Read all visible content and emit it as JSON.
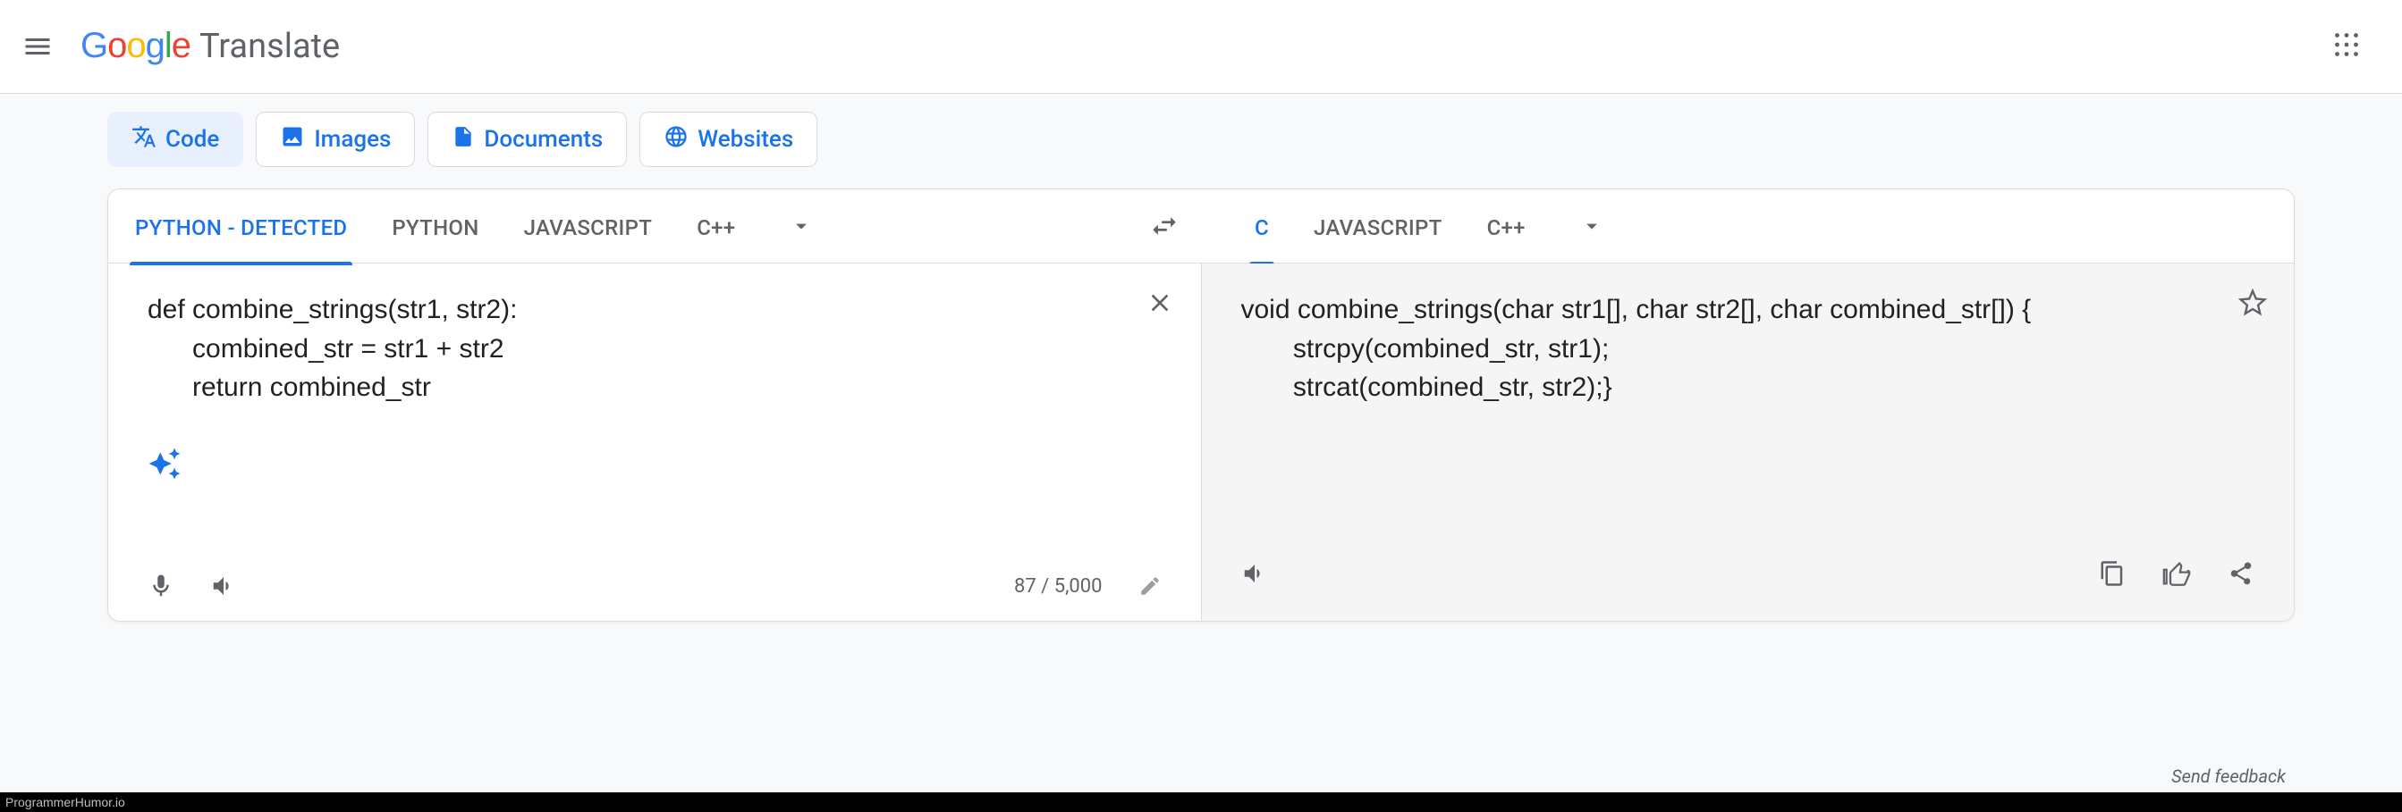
{
  "header": {
    "app_name": "Translate"
  },
  "modes": {
    "code": "Code",
    "images": "Images",
    "documents": "Documents",
    "websites": "Websites"
  },
  "source_langs": {
    "detected": "PYTHON - DETECTED",
    "python": "PYTHON",
    "javascript": "JAVASCRIPT",
    "cpp": "C++"
  },
  "target_langs": {
    "c": "C",
    "javascript": "JAVASCRIPT",
    "cpp": "C++"
  },
  "source_text": "def combine_strings(str1, str2):\n      combined_str = str1 + str2\n      return combined_str",
  "target_text": "void combine_strings(char str1[], char str2[], char combined_str[]) {\n       strcpy(combined_str, str1);\n       strcat(combined_str, str2);}",
  "char_count": "87 / 5,000",
  "feedback_label": "Send feedback",
  "watermark": "ProgrammerHumor.io"
}
